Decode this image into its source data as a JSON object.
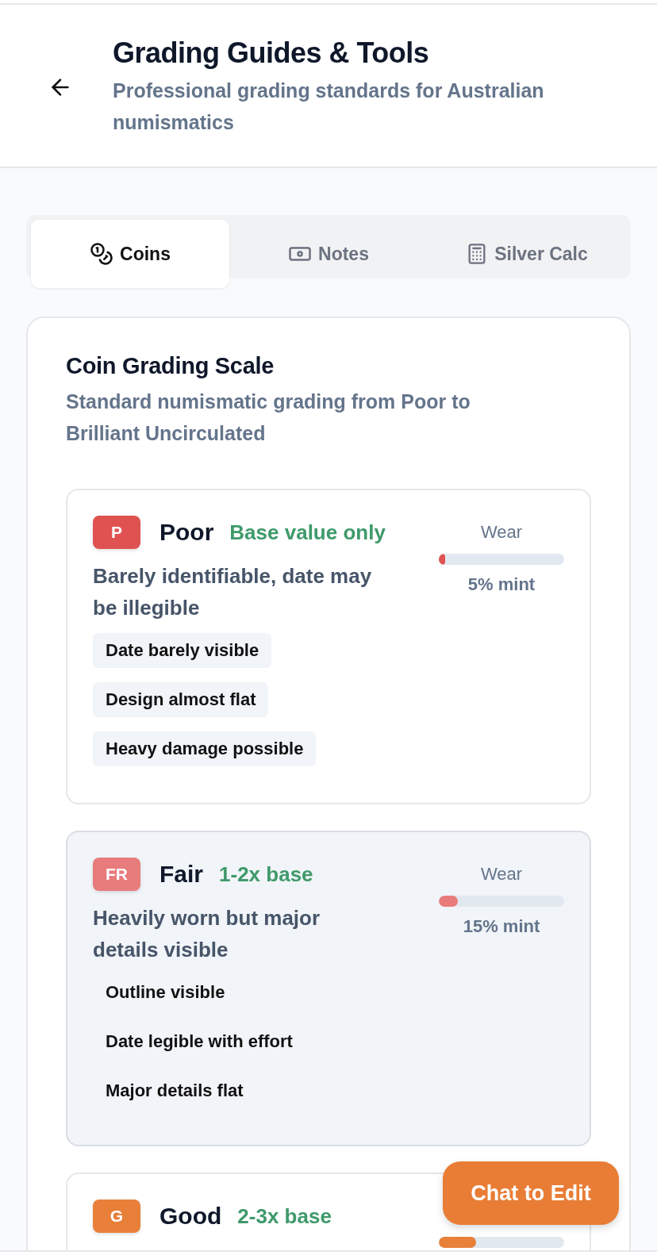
{
  "header": {
    "title": "Grading Guides & Tools",
    "subtitle": "Professional grading standards for Australian numismatics"
  },
  "tabs": [
    {
      "label": "Coins",
      "kind": "coins",
      "selected": true
    },
    {
      "label": "Notes",
      "kind": "notes",
      "selected": false
    },
    {
      "label": "Silver Calc",
      "kind": "calculator",
      "selected": false
    }
  ],
  "scale": {
    "title": "Coin Grading Scale",
    "subtitle": "Standard numismatic grading from Poor to Brilliant Uncirculated",
    "grades": [
      {
        "code": "P",
        "name": "Poor",
        "value": "Base value only",
        "description": "Barely identifiable, date may be illegible",
        "color": "#e05252",
        "highlighted": false,
        "wear_label": "Wear",
        "level": 0.05,
        "reading": "5% mint",
        "features": [
          "Date barely visible",
          "Design almost flat",
          "Heavy damage possible"
        ]
      },
      {
        "code": "FR",
        "name": "Fair",
        "value": "1-2x base",
        "description": "Heavily worn but major details visible",
        "color": "#e87b7b",
        "highlighted": true,
        "wear_label": "Wear",
        "level": 0.15,
        "reading": "15% mint",
        "features": [
          "Outline visible",
          "Date legible with effort",
          "Major details flat"
        ]
      },
      {
        "code": "G",
        "name": "Good",
        "value": "2-3x base",
        "color": "#e8803a",
        "highlighted": false,
        "level": 0.3
      }
    ]
  },
  "chat_button": "Chat to Edit"
}
